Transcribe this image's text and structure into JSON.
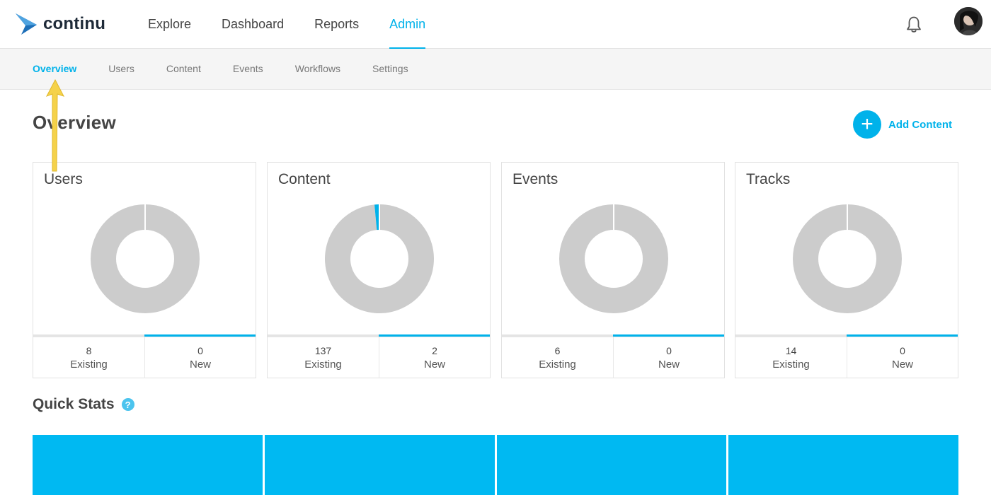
{
  "brand": {
    "name": "continu",
    "accent": "#00b2ea",
    "logo_color": "#1d6fb8"
  },
  "nav": {
    "items": [
      {
        "label": "Explore",
        "active": false
      },
      {
        "label": "Dashboard",
        "active": false
      },
      {
        "label": "Reports",
        "active": false
      },
      {
        "label": "Admin",
        "active": true
      }
    ],
    "icons": [
      "bell-icon",
      "avatar"
    ]
  },
  "subnav": {
    "items": [
      {
        "label": "Overview",
        "active": true
      },
      {
        "label": "Users",
        "active": false
      },
      {
        "label": "Content",
        "active": false
      },
      {
        "label": "Events",
        "active": false
      },
      {
        "label": "Workflows",
        "active": false
      },
      {
        "label": "Settings",
        "active": false
      }
    ]
  },
  "page": {
    "title": "Overview",
    "add_content": {
      "icon": "plus-icon",
      "symbol": "+",
      "label": "Add Content"
    }
  },
  "cards": [
    {
      "title": "Users",
      "existing": "8",
      "existing_label": "Existing",
      "new": "0",
      "new_label": "New"
    },
    {
      "title": "Content",
      "existing": "137",
      "existing_label": "Existing",
      "new": "2",
      "new_label": "New"
    },
    {
      "title": "Events",
      "existing": "6",
      "existing_label": "Existing",
      "new": "0",
      "new_label": "New"
    },
    {
      "title": "Tracks",
      "existing": "14",
      "existing_label": "Existing",
      "new": "0",
      "new_label": "New"
    }
  ],
  "chart_data": [
    {
      "type": "pie",
      "labels": [
        "Existing",
        "New"
      ],
      "values": [
        8,
        0
      ],
      "colors": [
        "#cccccc",
        "#00b2ea"
      ]
    },
    {
      "type": "pie",
      "labels": [
        "Existing",
        "New"
      ],
      "values": [
        137,
        2
      ],
      "colors": [
        "#cccccc",
        "#00b2ea"
      ]
    },
    {
      "type": "pie",
      "labels": [
        "Existing",
        "New"
      ],
      "values": [
        6,
        0
      ],
      "colors": [
        "#cccccc",
        "#00b2ea"
      ]
    },
    {
      "type": "pie",
      "labels": [
        "Existing",
        "New"
      ],
      "values": [
        14,
        0
      ],
      "colors": [
        "#cccccc",
        "#00b2ea"
      ]
    }
  ],
  "quick_stats": {
    "title": "Quick Stats",
    "help_symbol": "?",
    "tile_color": "#00b9f2",
    "tile_count": 4
  }
}
